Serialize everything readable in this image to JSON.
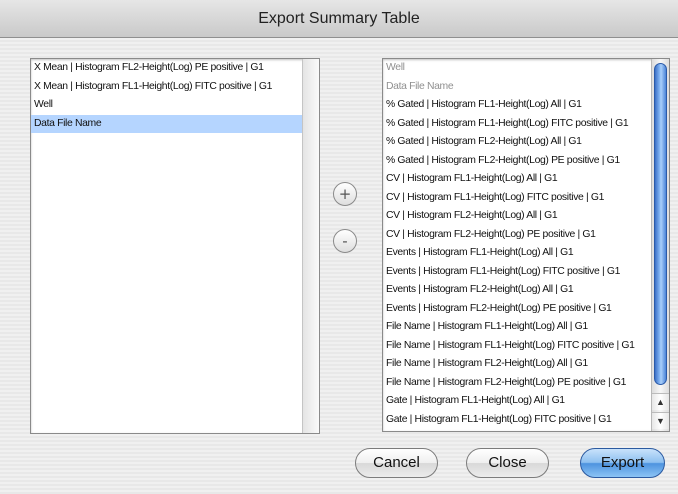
{
  "window": {
    "title": "Export Summary Table"
  },
  "left_list": {
    "items": [
      {
        "label": "X Mean | Histogram FL2-Height(Log) PE positive | G1",
        "selected": false,
        "dim": false
      },
      {
        "label": "X Mean | Histogram FL1-Height(Log) FITC positive | G1",
        "selected": false,
        "dim": false
      },
      {
        "label": "Well",
        "selected": false,
        "dim": false
      },
      {
        "label": "Data File Name",
        "selected": true,
        "dim": false
      }
    ]
  },
  "right_list": {
    "items": [
      {
        "label": "Well",
        "dim": true
      },
      {
        "label": "Data File Name",
        "dim": true
      },
      {
        "label": "% Gated | Histogram FL1-Height(Log) All | G1",
        "dim": false
      },
      {
        "label": "% Gated | Histogram FL1-Height(Log) FITC positive | G1",
        "dim": false
      },
      {
        "label": "% Gated | Histogram FL2-Height(Log) All | G1",
        "dim": false
      },
      {
        "label": "% Gated | Histogram FL2-Height(Log) PE positive | G1",
        "dim": false
      },
      {
        "label": "CV | Histogram FL1-Height(Log) All | G1",
        "dim": false
      },
      {
        "label": "CV | Histogram FL1-Height(Log) FITC positive | G1",
        "dim": false
      },
      {
        "label": "CV | Histogram FL2-Height(Log) All | G1",
        "dim": false
      },
      {
        "label": "CV | Histogram FL2-Height(Log) PE positive | G1",
        "dim": false
      },
      {
        "label": "Events | Histogram FL1-Height(Log) All | G1",
        "dim": false
      },
      {
        "label": "Events | Histogram FL1-Height(Log) FITC positive | G1",
        "dim": false
      },
      {
        "label": "Events | Histogram FL2-Height(Log) All | G1",
        "dim": false
      },
      {
        "label": "Events | Histogram FL2-Height(Log) PE positive | G1",
        "dim": false
      },
      {
        "label": "File Name | Histogram FL1-Height(Log) All | G1",
        "dim": false
      },
      {
        "label": "File Name | Histogram FL1-Height(Log) FITC positive | G1",
        "dim": false
      },
      {
        "label": "File Name | Histogram FL2-Height(Log) All | G1",
        "dim": false
      },
      {
        "label": "File Name | Histogram FL2-Height(Log) PE positive | G1",
        "dim": false
      },
      {
        "label": "Gate | Histogram FL1-Height(Log) All | G1",
        "dim": false
      },
      {
        "label": "Gate | Histogram FL1-Height(Log) FITC positive | G1",
        "dim": false
      }
    ],
    "scrollbar": {
      "up_arrow": "▲",
      "down_arrow": "▼"
    }
  },
  "move_buttons": {
    "add_label": "+",
    "remove_label": "-"
  },
  "footer": {
    "cancel_label": "Cancel",
    "close_label": "Close",
    "export_label": "Export"
  },
  "colors": {
    "selection": "#b5d5ff",
    "default_button": "#5a9be6",
    "dim_text": "#909090"
  },
  "icons": {
    "add": "plus-icon",
    "remove": "minus-icon",
    "scroll_up": "arrow-up-icon",
    "scroll_down": "arrow-down-icon"
  }
}
